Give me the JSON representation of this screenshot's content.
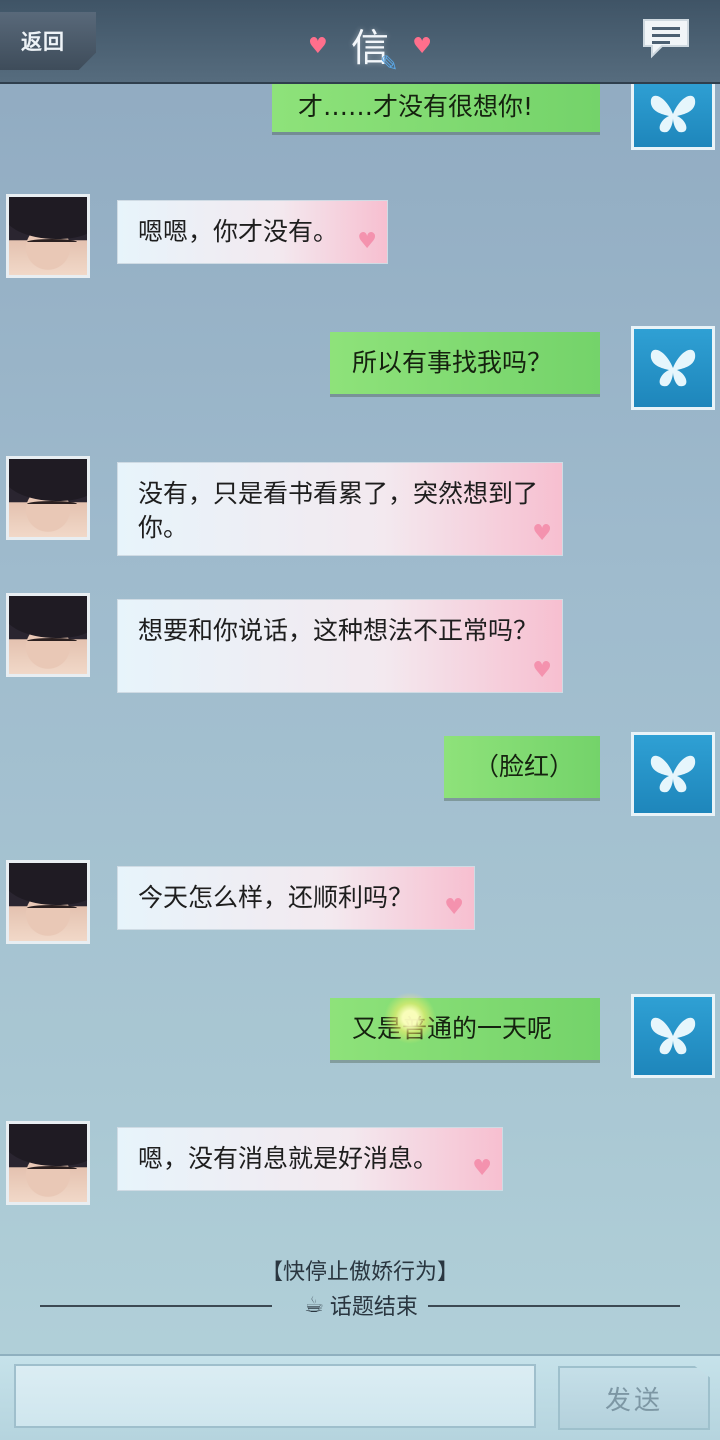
{
  "header": {
    "back_label": "返回",
    "title": "信",
    "heart_glyph": "♥",
    "edit_glyph": "✎"
  },
  "messages": [
    {
      "side": "right",
      "text": "才……才没有很想你!"
    },
    {
      "side": "left",
      "text": "嗯嗯，你才没有。"
    },
    {
      "side": "right",
      "text": "所以有事找我吗？"
    },
    {
      "side": "left",
      "text": "没有，只是看书看累了，突然想到了你。"
    },
    {
      "side": "left",
      "text": "想要和你说话，这种想法不正常吗？"
    },
    {
      "side": "right",
      "text": "（脸红）"
    },
    {
      "side": "left",
      "text": "今天怎么样，还顺利吗？"
    },
    {
      "side": "right",
      "text": "又是普通的一天呢"
    },
    {
      "side": "left",
      "text": "嗯，没有消息就是好消息。"
    }
  ],
  "system": {
    "hint": "【快停止傲娇行为】",
    "topic_end_icon": "☕",
    "topic_end": "话题结束"
  },
  "input": {
    "placeholder": "",
    "send_label": "发送"
  },
  "colors": {
    "header": "#4a5f71",
    "right_bubble": "#7ed870",
    "left_bubble_end": "#f7bfd0",
    "male_avatar": "#2fa0d4",
    "heart": "#f48aa8"
  }
}
